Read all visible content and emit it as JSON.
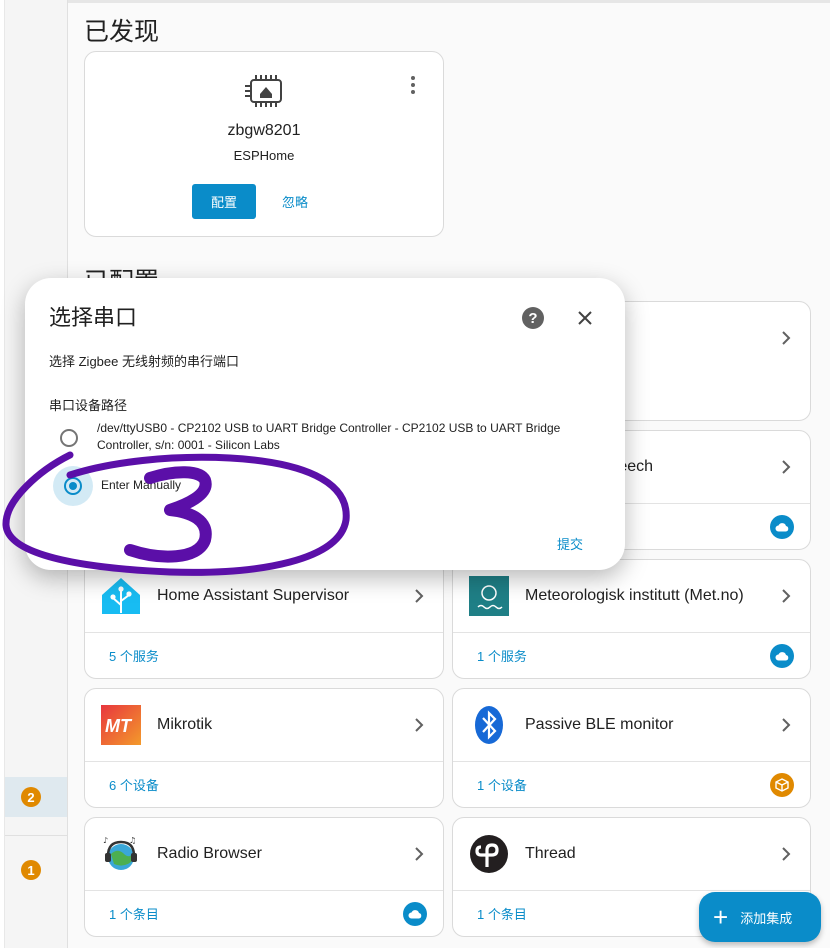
{
  "sidebar": {
    "badges": [
      {
        "value": "2",
        "active": true
      },
      {
        "value": "1",
        "active": false
      }
    ]
  },
  "discovered": {
    "section_title": "已发现",
    "card": {
      "name": "zbgw8201",
      "subtitle": "ESPHome",
      "configure_label": "配置",
      "ignore_label": "忽略",
      "icon": "zigbee-chip-home-icon"
    }
  },
  "configured": {
    "section_title": "已配置",
    "cards": [
      {
        "name": "",
        "link": "",
        "logo": "hidden"
      },
      {
        "name": "ate text-to-speech",
        "link": "",
        "badge": "cloud-icon"
      },
      {
        "name": "Home Assistant Supervisor",
        "link": "5 个服务",
        "logo": "home-assistant-logo"
      },
      {
        "name": "Meteorologisk institutt (Met.no)",
        "link": "1 个服务",
        "badge": "cloud-icon",
        "logo": "met-no-logo"
      },
      {
        "name": "Mikrotik",
        "link": "6 个设备",
        "logo": "mikrotik-logo"
      },
      {
        "name": "Passive BLE monitor",
        "link": "1 个设备",
        "badge": "package-icon",
        "logo": "bluetooth-logo"
      },
      {
        "name": "Radio Browser",
        "link": "1 个条目",
        "badge": "cloud-icon",
        "logo": "radio-browser-logo"
      },
      {
        "name": "Thread",
        "link": "1 个条目",
        "logo": "thread-logo"
      }
    ]
  },
  "fab": {
    "label": "添加集成",
    "icon": "plus-icon"
  },
  "dialog": {
    "title": "选择串口",
    "description": "选择 Zigbee 无线射频的串行端口",
    "field_label": "串口设备路径",
    "options": [
      {
        "label": "/dev/ttyUSB0 - CP2102 USB to UART Bridge Controller - CP2102 USB to UART Bridge Controller, s/n: 0001 - Silicon Labs",
        "selected": false
      },
      {
        "label": "Enter Manually",
        "selected": true
      }
    ],
    "submit_label": "提交",
    "help_icon": "help-circle-icon",
    "close_icon": "close-icon"
  },
  "annotation": {
    "text": "3",
    "color": "#5b0fa8"
  },
  "colors": {
    "primary": "#0a8cc9",
    "badge_orange": "#e08900"
  }
}
